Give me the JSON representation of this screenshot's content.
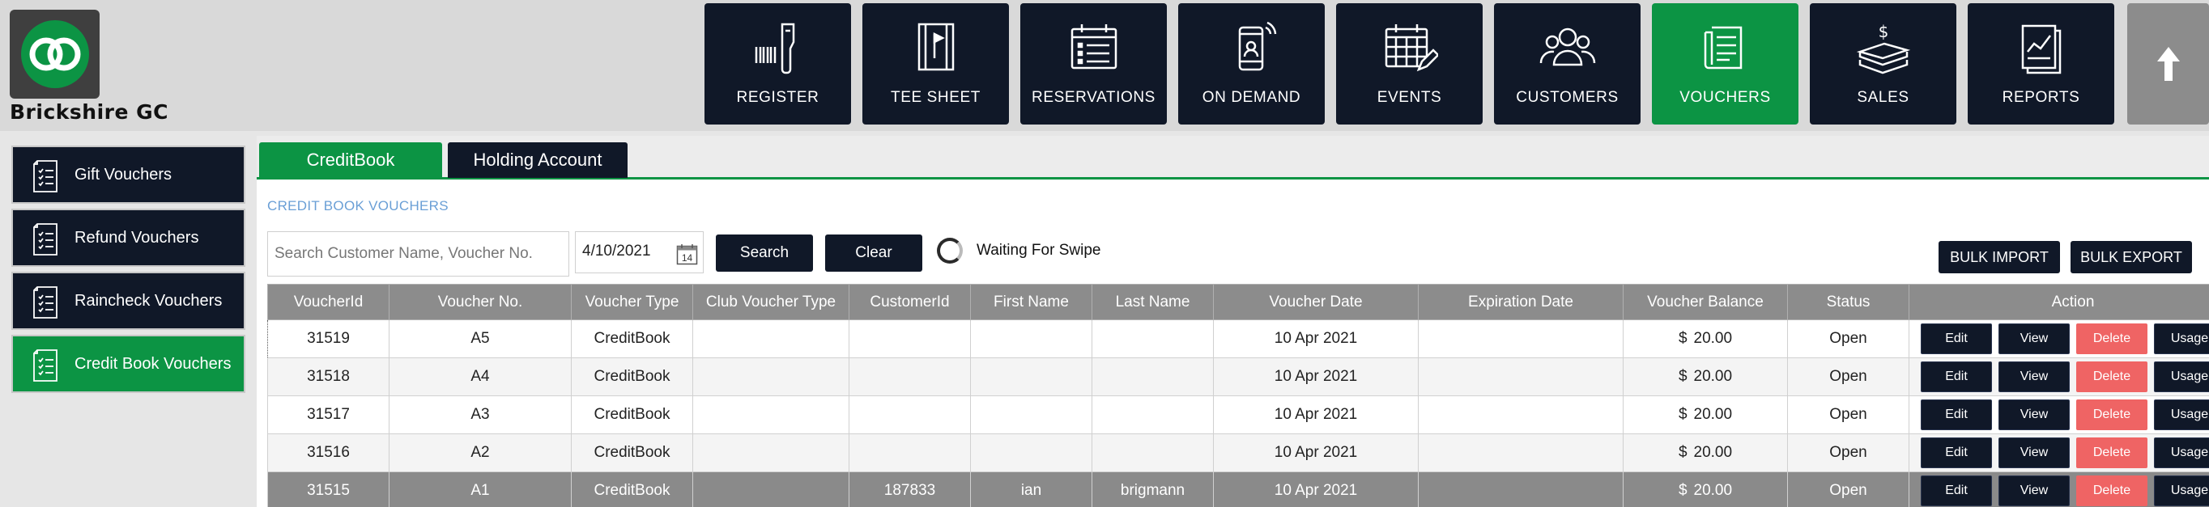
{
  "brand": {
    "club_name": "Brickshire GC",
    "accent": "#0c9444",
    "dark": "#101828",
    "link": "#6a9fd6"
  },
  "nav": [
    {
      "label": "REGISTER",
      "icon": "barcode-scanner-icon",
      "active": false
    },
    {
      "label": "TEE SHEET",
      "icon": "scorecard-flag-icon",
      "active": false
    },
    {
      "label": "RESERVATIONS",
      "icon": "calendar-list-icon",
      "active": false
    },
    {
      "label": "ON DEMAND",
      "icon": "mobile-phone-icon",
      "active": false
    },
    {
      "label": "EVENTS",
      "icon": "calendar-edit-icon",
      "active": false
    },
    {
      "label": "CUSTOMERS",
      "icon": "users-group-icon",
      "active": false
    },
    {
      "label": "VOUCHERS",
      "icon": "voucher-list-icon",
      "active": true
    },
    {
      "label": "SALES",
      "icon": "cash-stack-icon",
      "active": false
    },
    {
      "label": "REPORTS",
      "icon": "report-chart-icon",
      "active": false
    }
  ],
  "sidebar": {
    "items": [
      {
        "label": "Gift Vouchers",
        "active": false
      },
      {
        "label": "Refund Vouchers",
        "active": false
      },
      {
        "label": "Raincheck Vouchers",
        "active": false
      },
      {
        "label": "Credit Book Vouchers",
        "active": true
      }
    ]
  },
  "tabs": [
    {
      "label": "CreditBook",
      "active": true
    },
    {
      "label": "Holding Account",
      "active": false
    }
  ],
  "section_title": "CREDIT BOOK VOUCHERS",
  "search": {
    "placeholder": "Search Customer Name, Voucher No.",
    "value": ""
  },
  "date_value": "4/10/2021",
  "calendar_day": "14",
  "buttons": {
    "search": "Search",
    "clear": "Clear",
    "bulk_import": "BULK IMPORT",
    "bulk_export": "BULK EXPORT"
  },
  "swipe_status": "Waiting For Swipe",
  "table": {
    "columns": [
      "VoucherId",
      "Voucher No.",
      "Voucher Type",
      "Club Voucher Type",
      "CustomerId",
      "First Name",
      "Last Name",
      "Voucher Date",
      "Expiration Date",
      "Voucher Balance",
      "Status",
      "Action"
    ],
    "currency": "$",
    "action_labels": {
      "edit": "Edit",
      "view": "View",
      "delete": "Delete",
      "usage": "Usage"
    },
    "rows": [
      {
        "voucher_id": "31519",
        "voucher_no": "A5",
        "voucher_type": "CreditBook",
        "club_voucher_type": "",
        "customer_id": "",
        "first_name": "",
        "last_name": "",
        "voucher_date": "10 Apr 2021",
        "expiration_date": "",
        "balance": "20.00",
        "status": "Open"
      },
      {
        "voucher_id": "31518",
        "voucher_no": "A4",
        "voucher_type": "CreditBook",
        "club_voucher_type": "",
        "customer_id": "",
        "first_name": "",
        "last_name": "",
        "voucher_date": "10 Apr 2021",
        "expiration_date": "",
        "balance": "20.00",
        "status": "Open"
      },
      {
        "voucher_id": "31517",
        "voucher_no": "A3",
        "voucher_type": "CreditBook",
        "club_voucher_type": "",
        "customer_id": "",
        "first_name": "",
        "last_name": "",
        "voucher_date": "10 Apr 2021",
        "expiration_date": "",
        "balance": "20.00",
        "status": "Open"
      },
      {
        "voucher_id": "31516",
        "voucher_no": "A2",
        "voucher_type": "CreditBook",
        "club_voucher_type": "",
        "customer_id": "",
        "first_name": "",
        "last_name": "",
        "voucher_date": "10 Apr 2021",
        "expiration_date": "",
        "balance": "20.00",
        "status": "Open"
      },
      {
        "voucher_id": "31515",
        "voucher_no": "A1",
        "voucher_type": "CreditBook",
        "club_voucher_type": "",
        "customer_id": "187833",
        "first_name": "ian",
        "last_name": "brigmann",
        "voucher_date": "10 Apr 2021",
        "expiration_date": "",
        "balance": "20.00",
        "status": "Open"
      }
    ]
  }
}
